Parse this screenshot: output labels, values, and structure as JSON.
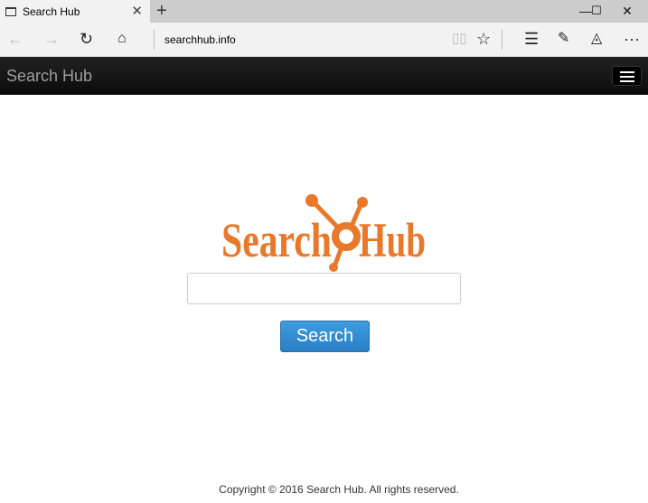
{
  "browser": {
    "tab_title": "Search Hub",
    "url": "searchhub.info"
  },
  "navbar": {
    "brand": "Search Hub"
  },
  "logo": {
    "text_left": "Search",
    "text_right": "Hub",
    "color": "#e8782a"
  },
  "search": {
    "placeholder": "",
    "value": "",
    "button_label": "Search",
    "button_color": "#2f8bd0"
  },
  "footer": {
    "copyright": "Copyright © 2016 Search Hub. All rights reserved."
  }
}
